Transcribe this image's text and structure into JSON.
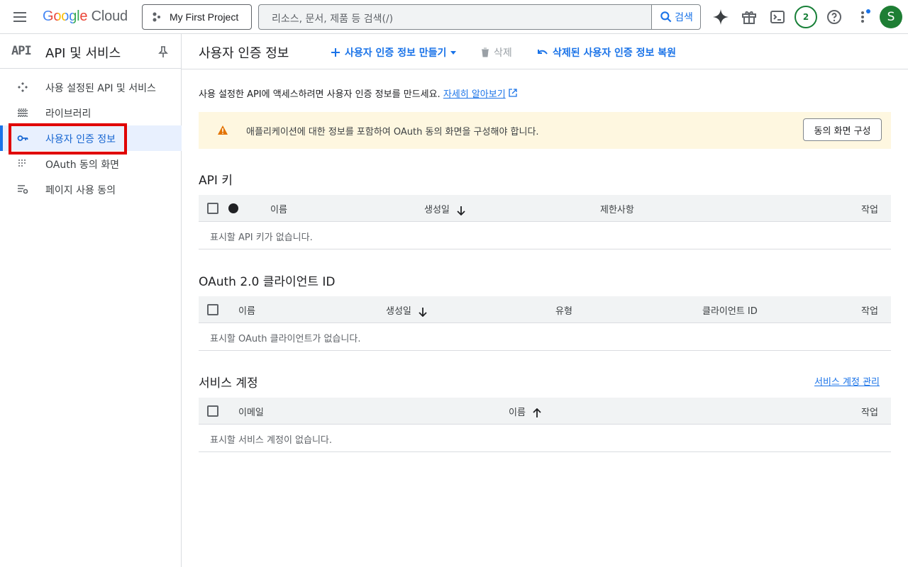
{
  "topbar": {
    "logo_google": "Google",
    "logo_cloud": "Cloud",
    "project": "My First Project",
    "search_placeholder": "리소스, 문서, 제품 등 검색(/)",
    "search_button": "검색",
    "notification_count": "2",
    "avatar_initial": "S"
  },
  "sidebar": {
    "logo": "API",
    "title": "API 및 서비스",
    "items": [
      {
        "label": "사용 설정된 API 및 서비스",
        "icon": "enabled-apis-icon",
        "active": false
      },
      {
        "label": "라이브러리",
        "icon": "library-icon",
        "active": false
      },
      {
        "label": "사용자 인증 정보",
        "icon": "key-icon",
        "active": true
      },
      {
        "label": "OAuth 동의 화면",
        "icon": "oauth-consent-icon",
        "active": false
      },
      {
        "label": "페이지 사용 동의",
        "icon": "page-usage-icon",
        "active": false
      }
    ]
  },
  "header": {
    "title": "사용자 인증 정보",
    "create_label": "사용자 인증 정보 만들기",
    "delete_label": "삭제",
    "restore_label": "삭제된 사용자 인증 정보 복원"
  },
  "intro": {
    "text": "사용 설정한 API에 액세스하려면 사용자 인증 정보를 만드세요.",
    "link": "자세히 알아보기"
  },
  "banner": {
    "text": "애플리케이션에 대한 정보를 포함하여 OAuth 동의 화면을 구성해야 합니다.",
    "button": "동의 화면 구성"
  },
  "api_keys": {
    "title": "API 키",
    "columns": [
      "이름",
      "생성일",
      "제한사항",
      "작업"
    ],
    "empty": "표시할 API 키가 없습니다."
  },
  "oauth": {
    "title": "OAuth 2.0 클라이언트 ID",
    "columns": [
      "이름",
      "생성일",
      "유형",
      "클라이언트 ID",
      "작업"
    ],
    "empty": "표시할 OAuth 클라이언트가 없습니다."
  },
  "service_accounts": {
    "title": "서비스 계정",
    "manage_link": "서비스 계정 관리",
    "columns": [
      "이메일",
      "이름",
      "작업"
    ],
    "empty": "표시할 서비스 계정이 없습니다."
  },
  "colors": {
    "accent": "#1a73e8",
    "warning": "#e37400",
    "highlight": "#e00000",
    "avatar": "#1e7e34"
  }
}
